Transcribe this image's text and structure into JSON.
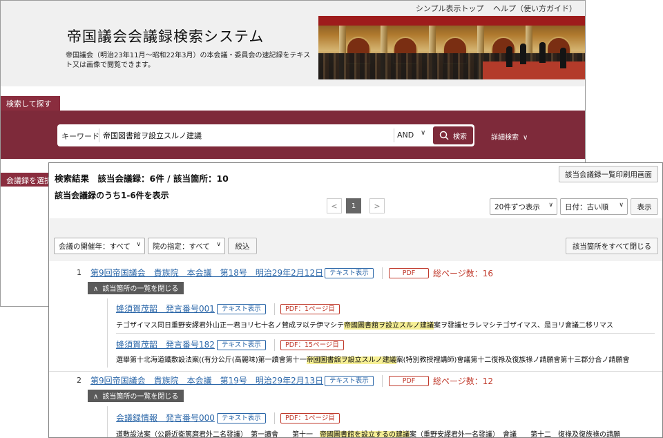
{
  "bg": {
    "top_links": [
      "シンプル表示トップ",
      "ヘルプ（使い方ガイド）"
    ],
    "title": "帝国議会会議録検索システム",
    "description": "帝国議会（明治23年11月～昭和22年3月）の本会議・委員会の速記録をテキスト又は画像で閲覧できます。",
    "tab_search": "検索して探す",
    "keyword_label": "キーワード",
    "keyword_value": "帝国図書館ヲ設立スルノ建議",
    "operator": "AND",
    "search_button": "検索",
    "advanced_search": "詳細検索",
    "tab_record": "会議録を選択"
  },
  "results": {
    "heading": "検索結果　該当会議録：6件 / 該当箇所：10",
    "subheading": "該当会議録のうち1-6件を表示",
    "print_button": "該当会議録一覧印刷用画面",
    "pager_prev": "<",
    "pager_current": "1",
    "pager_next": ">",
    "per_page": "20件ずつ表示",
    "sort": "日付：古い順",
    "show_button": "表示",
    "filter_year": "会議の開催年：すべて",
    "filter_house": "院の指定：すべて",
    "filter_button": "絞込",
    "close_all_button": "該当箇所をすべて閉じる"
  },
  "records": [
    {
      "num": "1",
      "title": "第9回帝国議会　貴族院　本会議　第18号　明治29年2月12日",
      "text_tag": "テキスト表示",
      "pdf_tag": "PDF",
      "pages": "総ページ数：16",
      "toggle": "該当箇所の一覧を閉じる",
      "hits": [
        {
          "speaker": "蜂須賀茂韶　発言番号001",
          "text_tag": "テキスト表示",
          "pdf_tag": "PDF：1ページ目",
          "pre": "テゴザイマス同日重野安繹君外山正一君ヨリ七十名ノ賛成ヲ以テ伊マシテ",
          "hit": "帝國圖書舘ヲ設立スルノ建議",
          "post": "案ヲ發議セラレマシテゴザイマス、是ヨリ會議二移リマス"
        },
        {
          "speaker": "蜂須賀茂韶　発言番号182",
          "text_tag": "テキスト表示",
          "pdf_tag": "PDF：15ページ目",
          "pre": "選舉第十北海道鐵敷設法案((有分公斤(高麗味)第一讀會第十一",
          "hit": "帝國圖書舘ヲ設立スルノ建議",
          "post": "案(特別教授裡講師)會議第十二復祿及復族祿ノ請願會第十三郡分合ノ請願會"
        }
      ]
    },
    {
      "num": "2",
      "title": "第9回帝国議会　貴族院　本会議　第19号　明治29年2月13日",
      "text_tag": "テキスト表示",
      "pdf_tag": "PDF",
      "pages": "総ページ数：12",
      "toggle": "該当箇所の一覧を閉じる",
      "hits": [
        {
          "speaker": "会議録情報　発言番号000",
          "text_tag": "テキスト表示",
          "pdf_tag": "PDF：1ページ目",
          "pre": "道敷設法案（公爵近衞篤麿君外二名發議）　第一讀會　　第十一　",
          "hit": "帝國圖書館を設立するの建議",
          "post": "案（重野安繹君外一名發議）　會議　　第十二　復祿及復族祿の請願"
        }
      ]
    }
  ],
  "colors": {
    "maroon": "#7e2a3a",
    "link": "#2a66a8",
    "pdf_red": "#c0392b",
    "highlight": "#f6ef95"
  }
}
